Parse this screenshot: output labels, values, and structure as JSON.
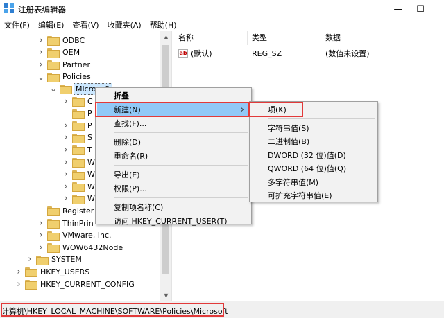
{
  "window": {
    "title": "注册表编辑器",
    "min_symbol": "—",
    "max_symbol": "☐"
  },
  "menu": [
    "文件(F)",
    "编辑(E)",
    "查看(V)",
    "收藏夹(A)",
    "帮助(H)"
  ],
  "tree": [
    {
      "label": "ODBC",
      "level": 2,
      "exp": ">"
    },
    {
      "label": "OEM",
      "level": 2,
      "exp": ">"
    },
    {
      "label": "Partner",
      "level": 2,
      "exp": ">"
    },
    {
      "label": "Policies",
      "level": 2,
      "exp": "v"
    },
    {
      "label": "Microsoft",
      "level": 3,
      "exp": "v",
      "selected": true
    },
    {
      "label": "C",
      "level": 4,
      "exp": ">"
    },
    {
      "label": "P",
      "level": 4,
      "exp": ""
    },
    {
      "label": "P",
      "level": 4,
      "exp": ">"
    },
    {
      "label": "S",
      "level": 4,
      "exp": ">"
    },
    {
      "label": "T",
      "level": 4,
      "exp": ">"
    },
    {
      "label": "W",
      "level": 4,
      "exp": ">"
    },
    {
      "label": "W",
      "level": 4,
      "exp": ">"
    },
    {
      "label": "W",
      "level": 4,
      "exp": ">"
    },
    {
      "label": "W",
      "level": 4,
      "exp": ">"
    },
    {
      "label": "Register",
      "level": 2,
      "exp": ""
    },
    {
      "label": "ThinPrin",
      "level": 2,
      "exp": ">"
    },
    {
      "label": "VMware, Inc.",
      "level": 2,
      "exp": ">"
    },
    {
      "label": "WOW6432Node",
      "level": 2,
      "exp": ">"
    },
    {
      "label": "SYSTEM",
      "level": 1,
      "exp": ">"
    },
    {
      "label": "HKEY_USERS",
      "level": 0,
      "exp": ">"
    },
    {
      "label": "HKEY_CURRENT_CONFIG",
      "level": 0,
      "exp": ">"
    }
  ],
  "list": {
    "headers": [
      "名称",
      "类型",
      "数据"
    ],
    "rows": [
      {
        "icon": "ab",
        "name": "(默认)",
        "type": "REG_SZ",
        "data": "(数值未设置)"
      }
    ]
  },
  "status": {
    "path": "计算机\\HKEY_LOCAL_MACHINE\\SOFTWARE\\Policies\\Microsoft"
  },
  "context_menu": {
    "items": [
      {
        "label": "折叠",
        "bold": true
      },
      {
        "label": "新建(N)",
        "hover": true,
        "submenu": true
      },
      {
        "label": "查找(F)..."
      },
      {
        "sep": true
      },
      {
        "label": "删除(D)"
      },
      {
        "label": "重命名(R)"
      },
      {
        "sep": true
      },
      {
        "label": "导出(E)"
      },
      {
        "label": "权限(P)..."
      },
      {
        "sep": true
      },
      {
        "label": "复制项名称(C)"
      },
      {
        "label": "访问 HKEY_CURRENT_USER(T)"
      }
    ]
  },
  "submenu": {
    "items": [
      {
        "label": "项(K)"
      },
      {
        "sep": true
      },
      {
        "label": "字符串值(S)"
      },
      {
        "label": "二进制值(B)"
      },
      {
        "label": "DWORD (32 位)值(D)"
      },
      {
        "label": "QWORD (64 位)值(Q)"
      },
      {
        "label": "多字符串值(M)"
      },
      {
        "label": "可扩充字符串值(E)"
      }
    ]
  },
  "colors": {
    "highlight_red": "#e23a3a",
    "hover_blue": "#91c9f7",
    "folder_yellow": "#f0cf6e"
  }
}
